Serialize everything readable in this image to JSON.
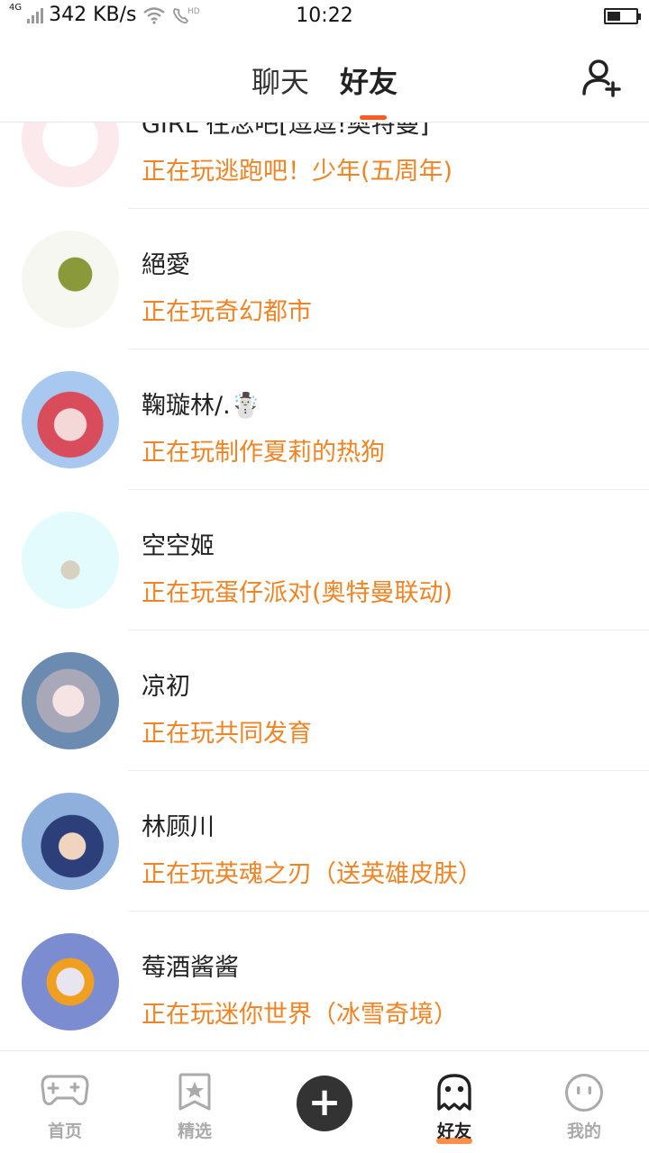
{
  "status_bar": {
    "network": "4G",
    "speed": "342 KB/s",
    "time": "10:22"
  },
  "header": {
    "tabs": [
      {
        "label": "聊天",
        "active": false
      },
      {
        "label": "好友",
        "active": true
      }
    ],
    "add_friend_icon": "add-user-icon",
    "accent_color": "#ff5a1f"
  },
  "friends": [
    {
      "name": "GIRL 往念吧[逗逗!奥特曼]",
      "status": "正在玩逃跑吧！少年(五周年)"
    },
    {
      "name": "絕愛",
      "status": "正在玩奇幻都市"
    },
    {
      "name": "鞠璇林/.☃️",
      "status": "正在玩制作夏莉的热狗"
    },
    {
      "name": "空空姬",
      "status": "正在玩蛋仔派对(奥特曼联动)"
    },
    {
      "name": "凉初",
      "status": "正在玩共同发育"
    },
    {
      "name": "林顾川",
      "status": "正在玩英魂之刃（送英雄皮肤）"
    },
    {
      "name": "莓酒酱酱",
      "status": "正在玩迷你世界（冰雪奇境）"
    }
  ],
  "status_color": "#f08424",
  "bottom_nav": {
    "items": [
      {
        "label": "首页",
        "icon": "gamepad-icon",
        "active": false
      },
      {
        "label": "精选",
        "icon": "star-bookmark-icon",
        "active": false
      },
      {
        "label": "",
        "icon": "plus-icon",
        "active": false
      },
      {
        "label": "好友",
        "icon": "ghost-icon",
        "active": true
      },
      {
        "label": "我的",
        "icon": "face-icon",
        "active": false
      }
    ]
  }
}
